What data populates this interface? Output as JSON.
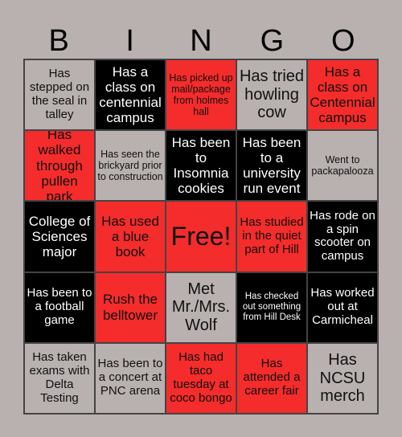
{
  "header": {
    "letters": [
      "B",
      "I",
      "N",
      "G",
      "O"
    ]
  },
  "colors": {
    "grey": "#b9b0b0",
    "black": "#000000",
    "red": "#f42c2c"
  },
  "cells": [
    {
      "text": "Has stepped on the seal in talley",
      "color": "grey"
    },
    {
      "text": "Has a class on centennial campus",
      "color": "black"
    },
    {
      "text": "Has picked up mail/package from holmes hall",
      "color": "red"
    },
    {
      "text": "Has tried howling cow",
      "color": "grey"
    },
    {
      "text": "Has a class on Centennial campus",
      "color": "red"
    },
    {
      "text": "Has walked through pullen park",
      "color": "red"
    },
    {
      "text": "Has seen the brickyard prior to construction",
      "color": "grey"
    },
    {
      "text": "Has been to Insomnia cookies",
      "color": "black"
    },
    {
      "text": "Has been to a university run event",
      "color": "black"
    },
    {
      "text": "Went to packapalooza",
      "color": "grey"
    },
    {
      "text": "College of Sciences major",
      "color": "black"
    },
    {
      "text": "Has used a blue book",
      "color": "red"
    },
    {
      "text": "Free!",
      "color": "red"
    },
    {
      "text": "Has studied in the quiet part of Hill",
      "color": "red"
    },
    {
      "text": "Has rode on a spin scooter on campus",
      "color": "black"
    },
    {
      "text": "Has been to a football game",
      "color": "black"
    },
    {
      "text": "Rush the belltower",
      "color": "red"
    },
    {
      "text": "Met Mr./Mrs. Wolf",
      "color": "grey"
    },
    {
      "text": "Has checked out something from Hill Desk",
      "color": "black"
    },
    {
      "text": "Has worked out at Carmicheal",
      "color": "black"
    },
    {
      "text": "Has taken exams with Delta Testing",
      "color": "grey"
    },
    {
      "text": "Has been to a concert at PNC arena",
      "color": "grey"
    },
    {
      "text": "Has had taco tuesday at coco bongo",
      "color": "red"
    },
    {
      "text": "Has attended a career fair",
      "color": "red"
    },
    {
      "text": "Has NCSU merch",
      "color": "grey"
    }
  ]
}
